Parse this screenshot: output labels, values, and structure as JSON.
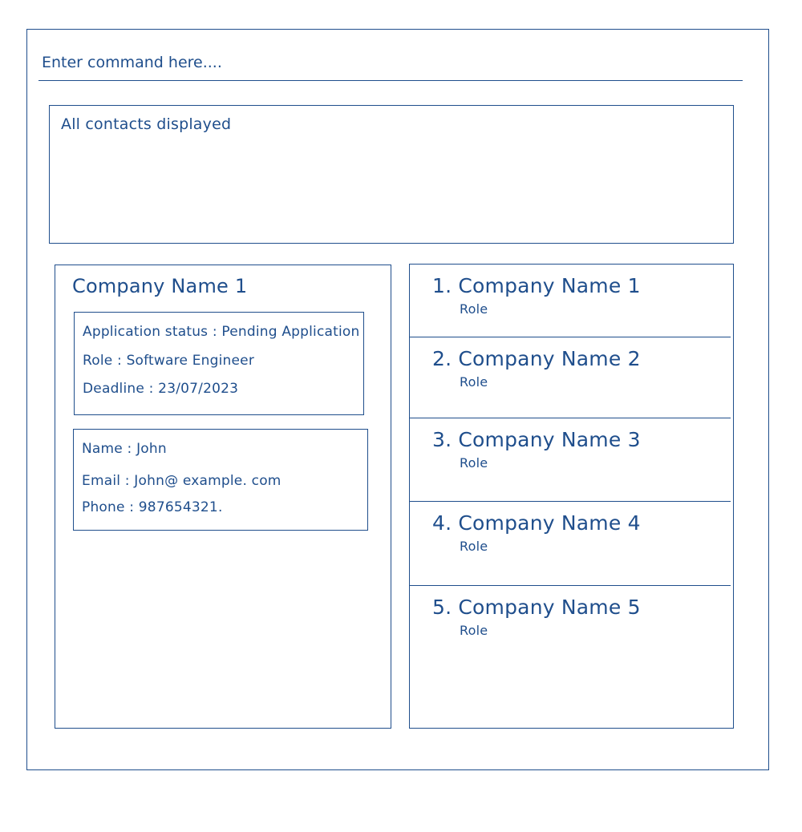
{
  "command_box": {
    "placeholder": "Enter command here...."
  },
  "result_display": {
    "text": "All contacts displayed"
  },
  "detail": {
    "company_name": "Company Name 1",
    "application": {
      "status": "Application status : Pending Application",
      "role": "Role : Software Engineer",
      "deadline": "Deadline : 23/07/2023"
    },
    "contact": {
      "name": "Name : John",
      "email": "Email : John@ example. com",
      "phone": "Phone : 987654321."
    }
  },
  "list": {
    "items": [
      {
        "name": "1. Company Name 1",
        "role": "Role"
      },
      {
        "name": "2. Company Name 2",
        "role": "Role"
      },
      {
        "name": "3. Company Name 3",
        "role": "Role"
      },
      {
        "name": "4. Company Name 4",
        "role": "Role"
      },
      {
        "name": "5. Company Name 5",
        "role": "Role"
      }
    ]
  },
  "colors": {
    "ink": "#1f4e8c",
    "background": "#ffffff"
  }
}
